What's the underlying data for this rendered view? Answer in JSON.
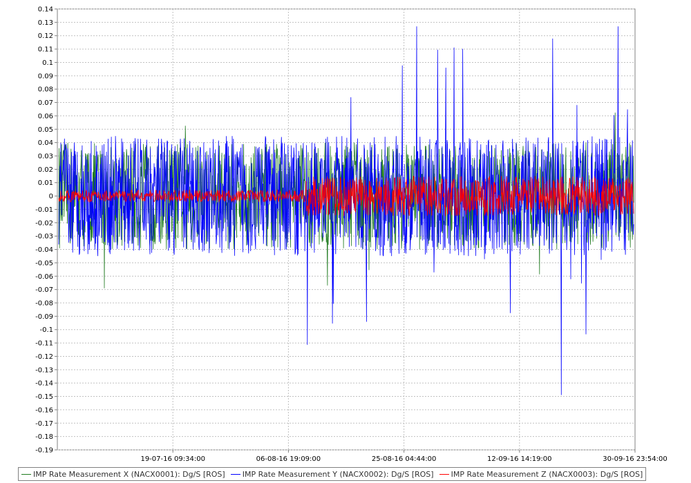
{
  "chart_data": {
    "type": "line",
    "title": "",
    "xlabel": "",
    "ylabel": "",
    "ylim": [
      -0.19,
      0.14
    ],
    "ytick_step": 0.01,
    "x_ticks": [
      "19-07-16 09:34:00",
      "06-08-16 19:09:00",
      "25-08-16 04:44:00",
      "12-09-16 14:19:00",
      "30-09-16 23:54:00"
    ],
    "grid": true,
    "legend_position": "bottom",
    "series": [
      {
        "name": "IMP Rate Measurement X (NACX0001): Dg/S [ROS]",
        "color": "#1f7a1f",
        "typical_amplitude": 0.04,
        "min": -0.077,
        "max": 0.072
      },
      {
        "name": "IMP Rate Measurement Y (NACX0002): Dg/S [ROS]",
        "color": "#0000ff",
        "typical_amplitude": 0.045,
        "min": -0.175,
        "max": 0.127
      },
      {
        "name": "IMP Rate Measurement Z (NACX0003): Dg/S [ROS]",
        "color": "#ff0000",
        "typical_amplitude": 0.015,
        "min": -0.046,
        "max": 0.04
      }
    ]
  }
}
